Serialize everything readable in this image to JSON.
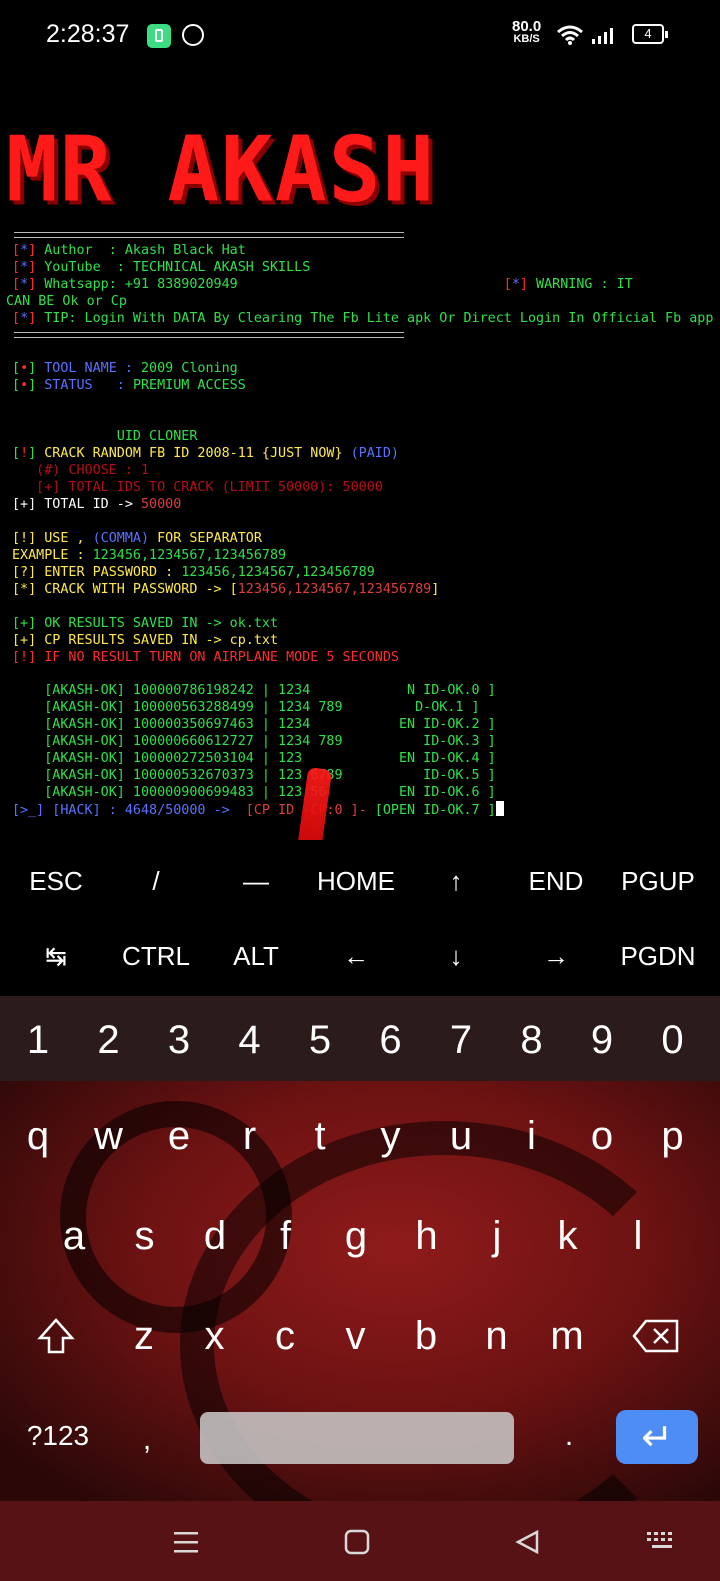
{
  "status_bar": {
    "time": "2:28:37",
    "net_speed": "80.0",
    "net_unit": "KB/S",
    "battery": "4"
  },
  "terminal": {
    "banner": "MR AKASH",
    "lines": [
      {
        "segments": [
          {
            "t": "[",
            "c": "r"
          },
          {
            "t": "*",
            "c": "b"
          },
          {
            "t": "]",
            "c": "r"
          },
          {
            "t": " Author  : Akash Black Hat",
            "c": "g"
          }
        ]
      },
      {
        "segments": [
          {
            "t": "[",
            "c": "r"
          },
          {
            "t": "*",
            "c": "b"
          },
          {
            "t": "]",
            "c": "r"
          },
          {
            "t": " YouTube  : TECHNICAL AKASH SKILLS",
            "c": "g"
          }
        ]
      },
      {
        "segments": [
          {
            "t": "[",
            "c": "r"
          },
          {
            "t": "*",
            "c": "b"
          },
          {
            "t": "]",
            "c": "r"
          },
          {
            "t": " Whatsapp: +91 8389020949                                 ",
            "c": "g"
          },
          {
            "t": "[",
            "c": "r"
          },
          {
            "t": "*",
            "c": "b"
          },
          {
            "t": "]",
            "c": "r"
          },
          {
            "t": " WARNING : IT",
            "c": "g"
          }
        ]
      },
      {
        "segments": [
          {
            "t": "CAN BE Ok or Cp",
            "c": "g"
          }
        ]
      },
      {
        "segments": [
          {
            "t": "[",
            "c": "r"
          },
          {
            "t": "*",
            "c": "b"
          },
          {
            "t": "]",
            "c": "r"
          },
          {
            "t": " TIP: Login With DATA By Clearing The Fb Lite apk Or Direct Login In Official Fb app",
            "c": "g"
          }
        ]
      },
      {
        "segments": [
          {
            "t": "[",
            "c": "g"
          },
          {
            "t": "•",
            "c": "r"
          },
          {
            "t": "]",
            "c": "g"
          },
          {
            "t": " TOOL NAME : ",
            "c": "b"
          },
          {
            "t": "2009 Cloning",
            "c": "g"
          }
        ]
      },
      {
        "segments": [
          {
            "t": "[",
            "c": "g"
          },
          {
            "t": "•",
            "c": "r"
          },
          {
            "t": "]",
            "c": "g"
          },
          {
            "t": " STATUS   : ",
            "c": "b"
          },
          {
            "t": "PREMIUM ACCESS",
            "c": "g"
          }
        ]
      },
      {
        "segments": [
          {
            "t": "             UID CLONER",
            "c": "g"
          }
        ]
      },
      {
        "segments": [
          {
            "t": "[",
            "c": "g"
          },
          {
            "t": "!",
            "c": "r"
          },
          {
            "t": "]",
            "c": "g"
          },
          {
            "t": " CRACK RANDOM FB ID 2008-11 {JUST NOW} ",
            "c": "y"
          },
          {
            "t": "(PAID)",
            "c": "b"
          }
        ]
      },
      {
        "segments": [
          {
            "t": "   (#) CHOOSE : 1",
            "c": "dr"
          }
        ]
      },
      {
        "segments": [
          {
            "t": "   [+] TOTAL IDS TO CRACK (LIMIT 50000): 50000",
            "c": "dr"
          }
        ]
      },
      {
        "segments": [
          {
            "t": "[+] TOTAL ID -> ",
            "c": "w"
          },
          {
            "t": "50000",
            "c": "m"
          }
        ]
      },
      {
        "segments": [
          {
            "t": "[!] USE , ",
            "c": "y"
          },
          {
            "t": "(COMMA)",
            "c": "b"
          },
          {
            "t": " FOR SEPARATOR",
            "c": "y"
          }
        ]
      },
      {
        "segments": [
          {
            "t": "EXAMPLE : ",
            "c": "y"
          },
          {
            "t": "123456,1234567,123456789",
            "c": "g"
          }
        ]
      },
      {
        "segments": [
          {
            "t": "[?] ENTER PASSWORD : ",
            "c": "y"
          },
          {
            "t": "123456,1234567,123456789",
            "c": "g"
          }
        ]
      },
      {
        "segments": [
          {
            "t": "[*] CRACK WITH PASSWORD -> [",
            "c": "y"
          },
          {
            "t": "123456,1234567,123456789",
            "c": "m"
          },
          {
            "t": "]",
            "c": "y"
          }
        ]
      },
      {
        "segments": [
          {
            "t": "[+] OK RESULTS SAVED IN -> ok.txt",
            "c": "g"
          }
        ]
      },
      {
        "segments": [
          {
            "t": "[+] CP RESULTS SAVED IN -> cp.txt",
            "c": "y"
          }
        ]
      },
      {
        "segments": [
          {
            "t": "[!] IF NO RESULT TURN ON AIRPLANE MODE 5 SECONDS",
            "c": "r"
          }
        ]
      },
      {
        "segments": [
          {
            "t": "    [AKASH-OK] 100000786198242 | 1234            N ID-OK.0 ]",
            "c": "g"
          }
        ]
      },
      {
        "segments": [
          {
            "t": "    [AKASH-OK] 100000563288499 | 1234 789         D-OK.1 ]",
            "c": "g"
          }
        ]
      },
      {
        "segments": [
          {
            "t": "    [AKASH-OK] 100000350697463 | 1234           EN ID-OK.2 ]",
            "c": "g"
          }
        ]
      },
      {
        "segments": [
          {
            "t": "    [AKASH-OK] 100000660612727 | 1234 789          ID-OK.3 ]",
            "c": "g"
          }
        ]
      },
      {
        "segments": [
          {
            "t": "    [AKASH-OK] 100000272503104 | 123            EN ID-OK.4 ]",
            "c": "g"
          }
        ]
      },
      {
        "segments": [
          {
            "t": "    [AKASH-OK] 100000532670373 | 123 6789          ID-OK.5 ]",
            "c": "g"
          }
        ]
      },
      {
        "segments": [
          {
            "t": "    [AKASH-OK] 100000900699483 | 123 56         EN ID-OK.6 ]",
            "c": "g"
          }
        ]
      },
      {
        "segments": [
          {
            "t": "[>_] [HACK] : 4648/50000 ->  ",
            "c": "b"
          },
          {
            "t": "[CP ID -CP:0 ]- ",
            "c": "m"
          },
          {
            "t": "[OPEN ID-OK.7 ]",
            "c": "g"
          }
        ]
      }
    ]
  },
  "extra_keys": {
    "row1": [
      "ESC",
      "/",
      "—",
      "HOME",
      "↑",
      "END",
      "PGUP"
    ],
    "row2": [
      "↹",
      "CTRL",
      "ALT",
      "←",
      "↓",
      "→",
      "PGDN"
    ]
  },
  "keyboard": {
    "numbers": [
      "1",
      "2",
      "3",
      "4",
      "5",
      "6",
      "7",
      "8",
      "9",
      "0"
    ],
    "row_q": [
      "q",
      "w",
      "e",
      "r",
      "t",
      "y",
      "u",
      "i",
      "o",
      "p"
    ],
    "row_a": [
      "a",
      "s",
      "d",
      "f",
      "g",
      "h",
      "j",
      "k",
      "l"
    ],
    "row_z": [
      "z",
      "x",
      "c",
      "v",
      "b",
      "n",
      "m"
    ],
    "symbols_key": "?123",
    "comma_key": ",",
    "period_key": "."
  }
}
